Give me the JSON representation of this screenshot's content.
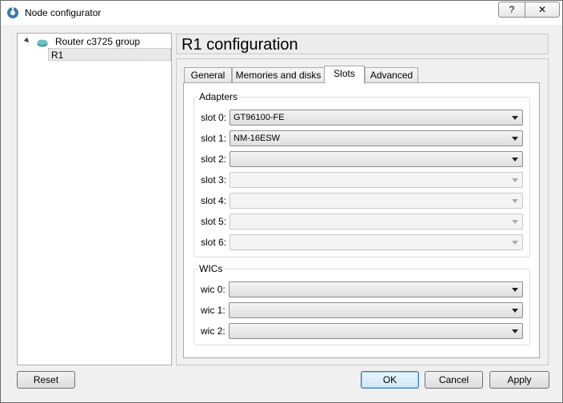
{
  "window": {
    "title": "Node configurator",
    "help_label": "?",
    "close_label": "✕",
    "app_icon": "gns3-app-icon"
  },
  "tree": {
    "group_label": "Router c3725 group",
    "group_icon": "router-icon",
    "child_label": "R1"
  },
  "header": {
    "title": "R1 configuration"
  },
  "tabs": [
    {
      "label": "General"
    },
    {
      "label": "Memories and disks"
    },
    {
      "label": "Slots"
    },
    {
      "label": "Advanced"
    }
  ],
  "adapters": {
    "title": "Adapters",
    "slots": [
      {
        "label": "slot 0:",
        "value": "GT96100-FE",
        "enabled": true
      },
      {
        "label": "slot 1:",
        "value": "NM-16ESW",
        "enabled": true
      },
      {
        "label": "slot 2:",
        "value": "",
        "enabled": true
      },
      {
        "label": "slot 3:",
        "value": "",
        "enabled": false
      },
      {
        "label": "slot 4:",
        "value": "",
        "enabled": false
      },
      {
        "label": "slot 5:",
        "value": "",
        "enabled": false
      },
      {
        "label": "slot 6:",
        "value": "",
        "enabled": false
      }
    ]
  },
  "wics": {
    "title": "WICs",
    "slots": [
      {
        "label": "wic 0:",
        "value": ""
      },
      {
        "label": "wic 1:",
        "value": ""
      },
      {
        "label": "wic 2:",
        "value": ""
      }
    ]
  },
  "buttons": {
    "reset": "Reset",
    "ok": "OK",
    "cancel": "Cancel",
    "apply": "Apply"
  },
  "colors": {
    "default_button_border": "#3c7fb1",
    "window_bg": "#f0f0f0"
  }
}
